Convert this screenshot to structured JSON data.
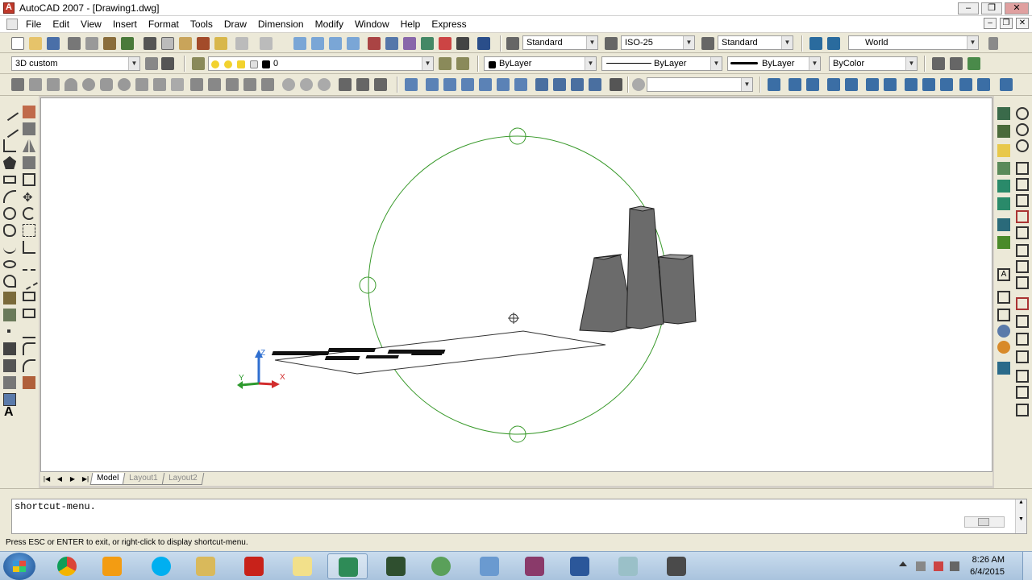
{
  "window": {
    "title": "AutoCAD 2007 - [Drawing1.dwg]",
    "minimize_glyph": "–",
    "restore_glyph": "❐",
    "close_glyph": "✕"
  },
  "menu": [
    "File",
    "Edit",
    "View",
    "Insert",
    "Format",
    "Tools",
    "Draw",
    "Dimension",
    "Modify",
    "Window",
    "Help",
    "Express"
  ],
  "toolbars": {
    "text_style": "Standard",
    "dim_style": "ISO-25",
    "table_style": "Standard",
    "ucs": "World",
    "workspace": "3D custom",
    "layer": "0",
    "color": "ByLayer",
    "linetype": "ByLayer",
    "lineweight": "ByLayer",
    "plot_style": "ByColor"
  },
  "ucs_icon": {
    "x_label": "X",
    "y_label": "Y",
    "z_label": "Z"
  },
  "layout_tabs": [
    {
      "label": "Model",
      "active": true
    },
    {
      "label": "Layout1",
      "active": false
    },
    {
      "label": "Layout2",
      "active": false
    }
  ],
  "command_line": {
    "history": "shortcut-menu."
  },
  "status_text": "Press ESC or ENTER to exit, or right-click to display shortcut-menu.",
  "taskbar": {
    "apps": [
      "chrome",
      "media-player",
      "skype",
      "explorer",
      "acrobat",
      "folder",
      "autocad",
      "terminal",
      "maps",
      "photo",
      "winrar",
      "word",
      "notepad",
      "installer"
    ],
    "time": "8:26 AM",
    "date": "6/4/2015"
  },
  "colors": {
    "orbit": "#3a9a2c",
    "solid": "#6b6b6b",
    "axis_x": "#d22c2c",
    "axis_y": "#2e9a2e",
    "axis_z": "#2f6fd0"
  }
}
